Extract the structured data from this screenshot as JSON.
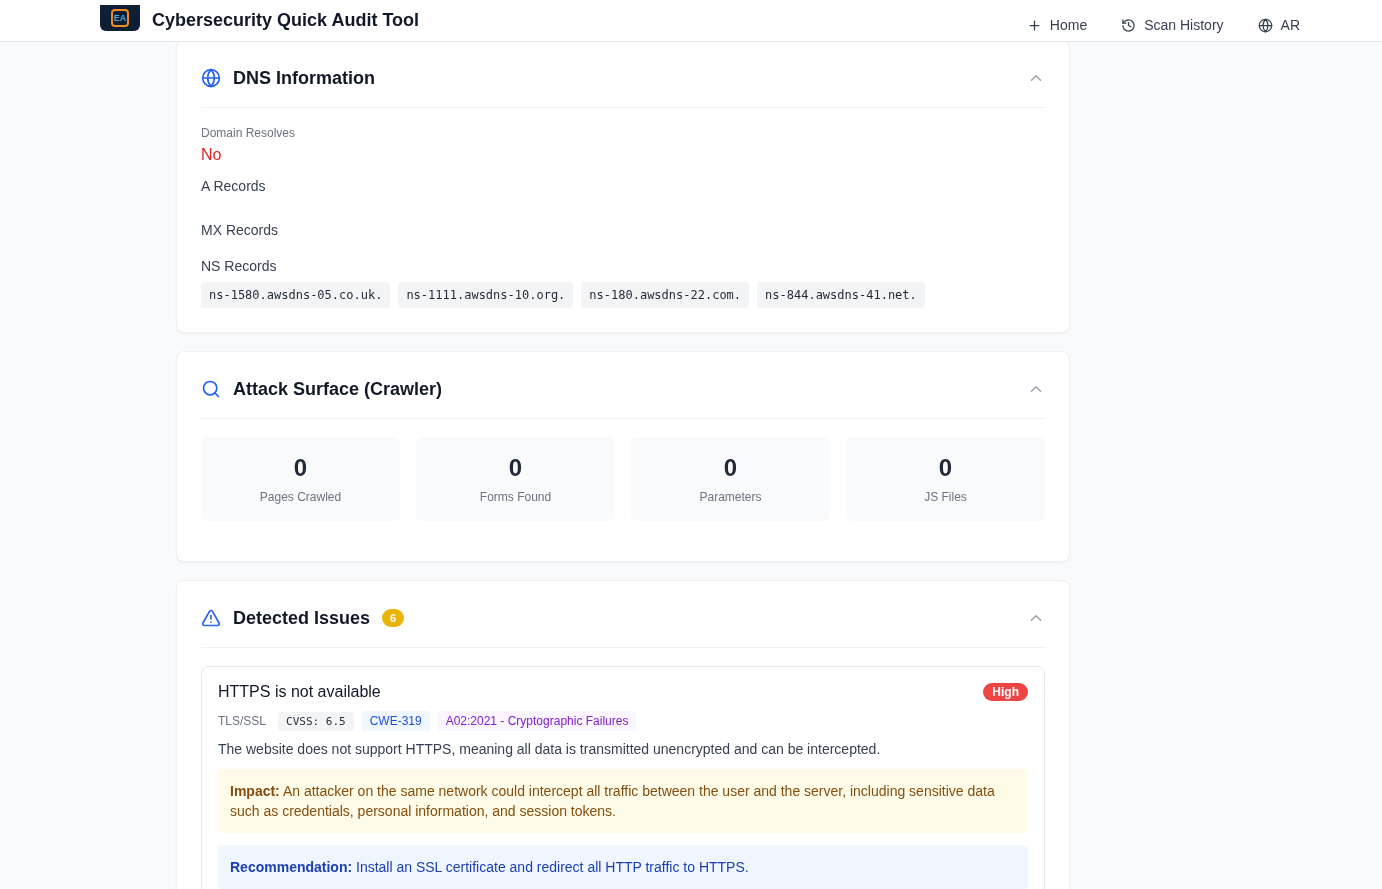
{
  "header": {
    "logo_text": "EA",
    "title": "Cybersecurity Quick Audit Tool",
    "nav": [
      {
        "kind": "plus",
        "label": "Home"
      },
      {
        "kind": "history",
        "label": "Scan History"
      },
      {
        "kind": "globe",
        "label": "AR"
      }
    ]
  },
  "dns": {
    "title": "DNS Information",
    "expanded": true,
    "resolves_label": "Domain Resolves",
    "resolves": false,
    "resolves_value": "No",
    "a_records_label": "A Records",
    "mx_records_label": "MX Records",
    "ns_records_label": "NS Records",
    "ns_records": [
      "ns-1580.awsdns-05.co.uk.",
      "ns-1111.awsdns-10.org.",
      "ns-180.awsdns-22.com.",
      "ns-844.awsdns-41.net."
    ]
  },
  "attack_surface": {
    "title": "Attack Surface (Crawler)",
    "expanded": true,
    "stats": [
      {
        "value": "0",
        "label": "Pages Crawled"
      },
      {
        "value": "0",
        "label": "Forms Found"
      },
      {
        "value": "0",
        "label": "Parameters"
      },
      {
        "value": "0",
        "label": "JS Files"
      }
    ]
  },
  "issues": {
    "title": "Detected Issues",
    "count": "6",
    "expanded": true,
    "items": [
      {
        "title": "HTTPS is not available",
        "severity": "High",
        "color": "#ef4444",
        "category": "TLS/SSL",
        "cvss": "CVSS: 6.5",
        "cwe": "CWE-319",
        "owasp": "A02:2021 - Cryptographic Failures",
        "description": "The website does not support HTTPS, meaning all data is transmitted unencrypted and can be intercepted.",
        "impact": "**Impact:** An attacker on the same network could intercept all traffic between the user and the server, including sensitive data such as credentials, personal information, and session tokens.",
        "recommendation": "**Recommendation:** Install an SSL certificate and redirect all HTTP traffic to HTTPS."
      }
    ]
  }
}
